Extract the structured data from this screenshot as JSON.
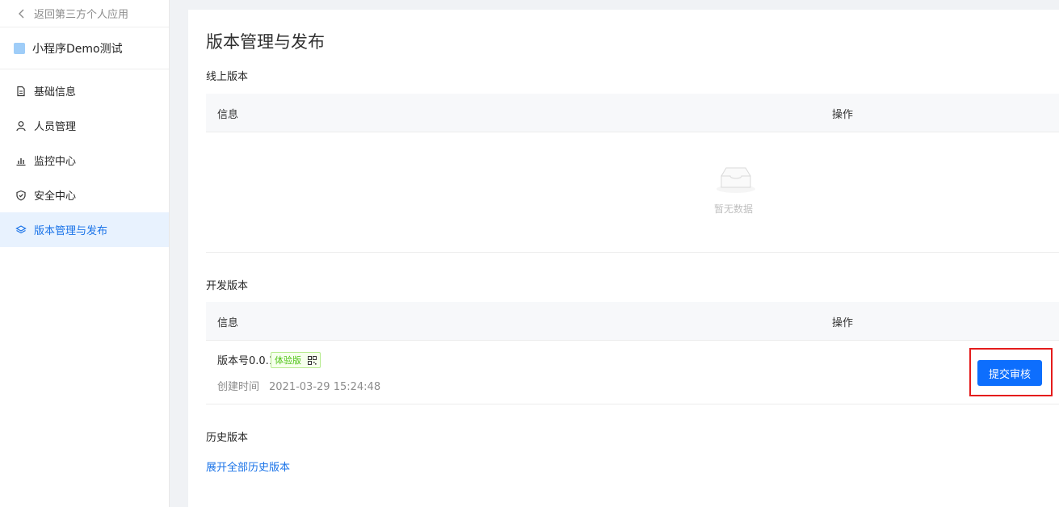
{
  "sidebar": {
    "back_label": "返回第三方个人应用",
    "app_name": "小程序Demo测试",
    "items": [
      {
        "label": "基础信息",
        "icon": "document-icon",
        "active": false
      },
      {
        "label": "人员管理",
        "icon": "user-icon",
        "active": false
      },
      {
        "label": "监控中心",
        "icon": "bar-chart-icon",
        "active": false
      },
      {
        "label": "安全中心",
        "icon": "shield-icon",
        "active": false
      },
      {
        "label": "版本管理与发布",
        "icon": "layers-icon",
        "active": true
      }
    ]
  },
  "main": {
    "title": "版本管理与发布",
    "online": {
      "label": "线上版本",
      "col_info": "信息",
      "col_action": "操作",
      "empty_text": "暂无数据"
    },
    "dev": {
      "label": "开发版本",
      "col_info": "信息",
      "col_action": "操作",
      "version": "版本号0.0.1",
      "tag": "体验版",
      "created_label": "创建时间",
      "created_time": "2021-03-29 15:24:48",
      "submit_label": "提交审核"
    },
    "history": {
      "label": "历史版本",
      "expand_label": "展开全部历史版本"
    }
  },
  "colors": {
    "accent": "#1a73e8",
    "button": "#0d6efd",
    "highlight_border": "#e41c1c",
    "tag_green": "#52c41a"
  }
}
